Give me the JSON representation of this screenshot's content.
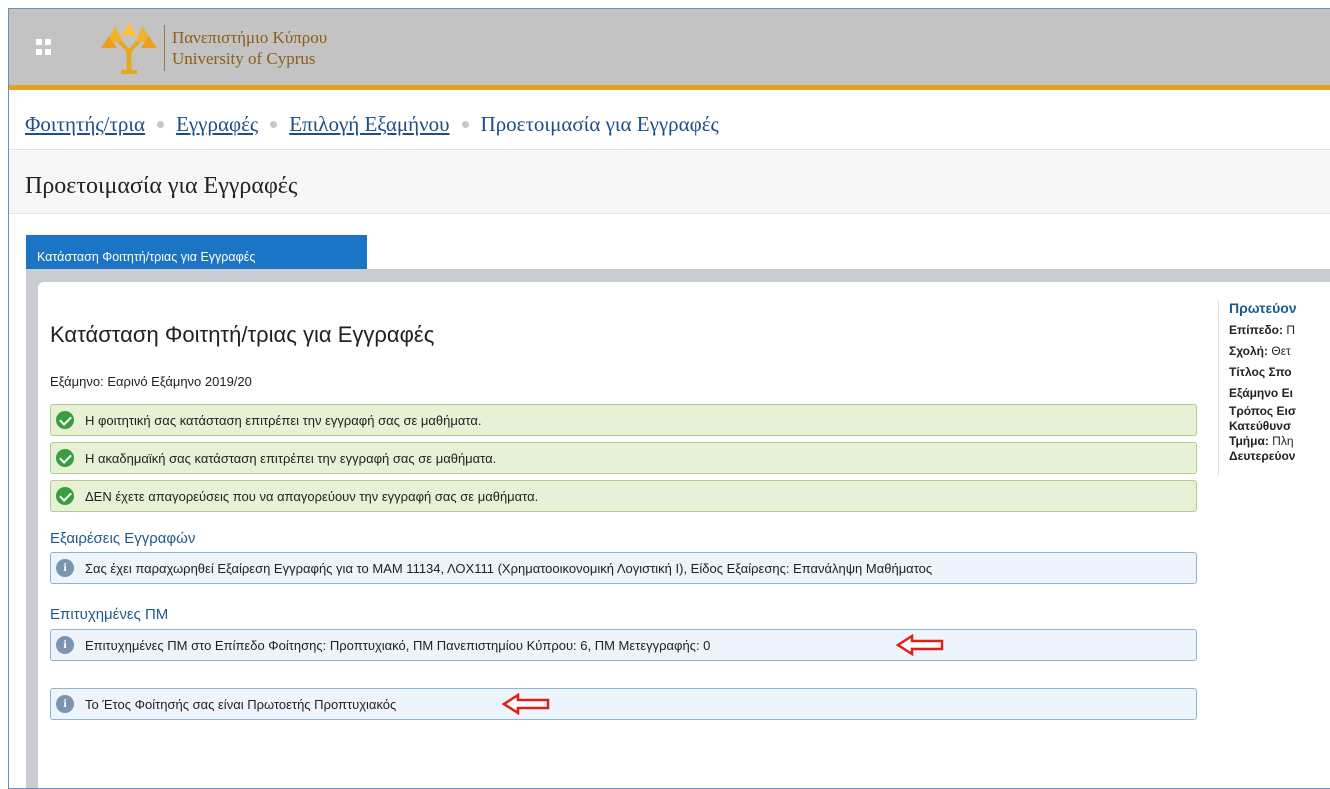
{
  "header": {
    "logo_line1": "Πανεπιστήμιο Κύπρου",
    "logo_line2": "University of Cyprus",
    "colors": {
      "bar": "#c3c3c3",
      "accent": "#e5a124"
    }
  },
  "breadcrumb": {
    "items": [
      {
        "label": "Φοιτητής/τρια"
      },
      {
        "label": "Εγγραφές"
      },
      {
        "label": "Επιλογή Εξαμήνου"
      }
    ],
    "current": "Προετοιμασία για Εγγραφές"
  },
  "page": {
    "title": "Προετοιμασία για Εγγραφές"
  },
  "tabs": [
    {
      "label": "Κατάσταση Φοιτητή/τριας για Εγγραφές",
      "active": true
    }
  ],
  "main": {
    "heading": "Κατάσταση Φοιτητή/τριας για Εγγραφές",
    "semester_label": "Εξάμηνο:",
    "semester_value": "Εαρινό Εξάμηνο 2019/20",
    "status_alerts": [
      {
        "text": "Η φοιτητική σας κατάσταση επιτρέπει την εγγραφή σας σε μαθήματα."
      },
      {
        "text": "Η ακαδημαϊκή σας κατάσταση επιτρέπει την εγγραφή σας σε μαθήματα."
      },
      {
        "text": "ΔΕΝ έχετε απαγορεύσεις που να απαγορεύουν την εγγραφή σας σε μαθήματα."
      }
    ],
    "exceptions_heading": "Εξαιρέσεις Εγγραφών",
    "exception_text": "Σας έχει παραχωρηθεί Εξαίρεση Εγγραφής για το ΜΑΜ 11134, ΛΟΧ111 (Χρηματοοικονομική Λογιστική Ι), Είδος Εξαίρεσης: Επανάληψη Μαθήματος",
    "credits_heading": "Επιτυχημένες ΠΜ",
    "credits_text": "Επιτυχημένες ΠΜ στο Επίπεδο Φοίτησης: Προπτυχιακό, ΠΜ Πανεπιστημίου Κύπρου: 6, ΠΜ Μετεγγραφής: 0",
    "year_text": "Το Έτος Φοίτησής σας είναι Πρωτοετής Προπτυχιακός"
  },
  "sidebar": {
    "heading": "Πρωτεύον",
    "rows": [
      {
        "label": "Επίπεδο:",
        "value": "Π"
      },
      {
        "label": "Σχολή:",
        "value": "Θετ"
      },
      {
        "label": "Τίτλος Σπο",
        "value": ""
      },
      {
        "label": "Εξάμηνο Ει",
        "value": ""
      },
      {
        "label": "Τρόπος Εισ",
        "value": ""
      },
      {
        "label": "Κατεύθυνσ",
        "value": ""
      },
      {
        "label": "Τμήμα:",
        "value": "Πλη"
      },
      {
        "label": "Δευτερεύον",
        "value": ""
      }
    ]
  }
}
